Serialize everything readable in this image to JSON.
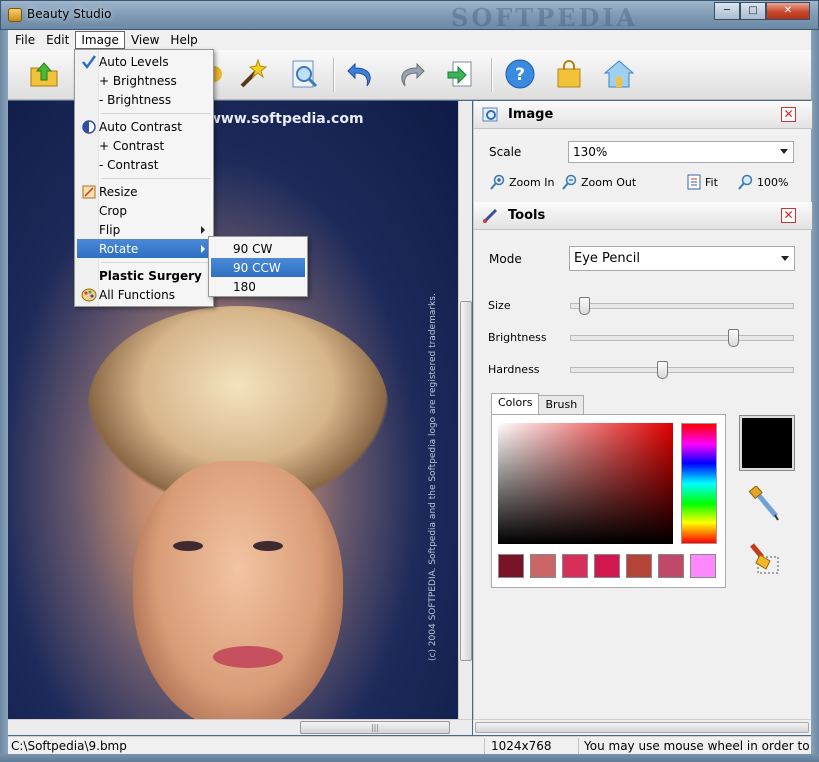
{
  "window": {
    "title": "Beauty Studio",
    "watermark": "SOFTPEDIA"
  },
  "menubar": {
    "items": [
      "File",
      "Edit",
      "Image",
      "View",
      "Help"
    ]
  },
  "image_menu": {
    "items": [
      {
        "label": "Auto Levels",
        "icon": "checkmark-icon",
        "checked": true
      },
      {
        "label": "+ Brightness"
      },
      {
        "label": "- Brightness"
      },
      {
        "label": "Auto Contrast",
        "icon": "contrast-icon"
      },
      {
        "label": "+ Contrast"
      },
      {
        "label": "- Contrast"
      },
      {
        "label": "Resize",
        "icon": "resize-icon"
      },
      {
        "label": "Crop"
      },
      {
        "label": "Flip",
        "submenu": true
      },
      {
        "label": "Rotate",
        "submenu": true,
        "highlighted": true
      },
      {
        "label": "Plastic Surgery",
        "bold": true
      },
      {
        "label": "All Functions",
        "icon": "palette-icon"
      }
    ]
  },
  "rotate_submenu": {
    "items": [
      "90 CW",
      "90 CCW",
      "180"
    ],
    "highlighted": "90 CCW"
  },
  "canvas": {
    "url_text": "www.softpedia.com",
    "side_text": "(c) 2004 SOFTPEDIA. Softpedia and the Softpedia logo are registered trademarks.",
    "menu_watermark": "SOFTPEDIA"
  },
  "image_panel": {
    "title": "Image",
    "scale_label": "Scale",
    "scale_value": "130%",
    "zoom_in": "Zoom In",
    "zoom_out": "Zoom Out",
    "fit": "Fit",
    "hundred": "100%"
  },
  "tools_panel": {
    "title": "Tools",
    "mode_label": "Mode",
    "mode_value": "Eye Pencil",
    "size_label": "Size",
    "size_level": 0.04,
    "brightness_label": "Brightness",
    "brightness_level": 0.74,
    "hardness_label": "Hardness",
    "hardness_level": 0.41,
    "tabs": [
      "Colors",
      "Brush"
    ],
    "selected_tab": "Colors",
    "swatches": [
      "#7a1228",
      "#cc6666",
      "#d6305a",
      "#d21850",
      "#b44438",
      "#c04868",
      "#ff88ff"
    ],
    "current_color": "#000000"
  },
  "statusbar": {
    "path": "C:\\Softpedia\\9.bmp",
    "dimensions": "1024x768",
    "hint": "You may use mouse wheel in order to sc"
  },
  "colors": {
    "accent": "#2f6fc2",
    "close_red": "#d22222"
  }
}
